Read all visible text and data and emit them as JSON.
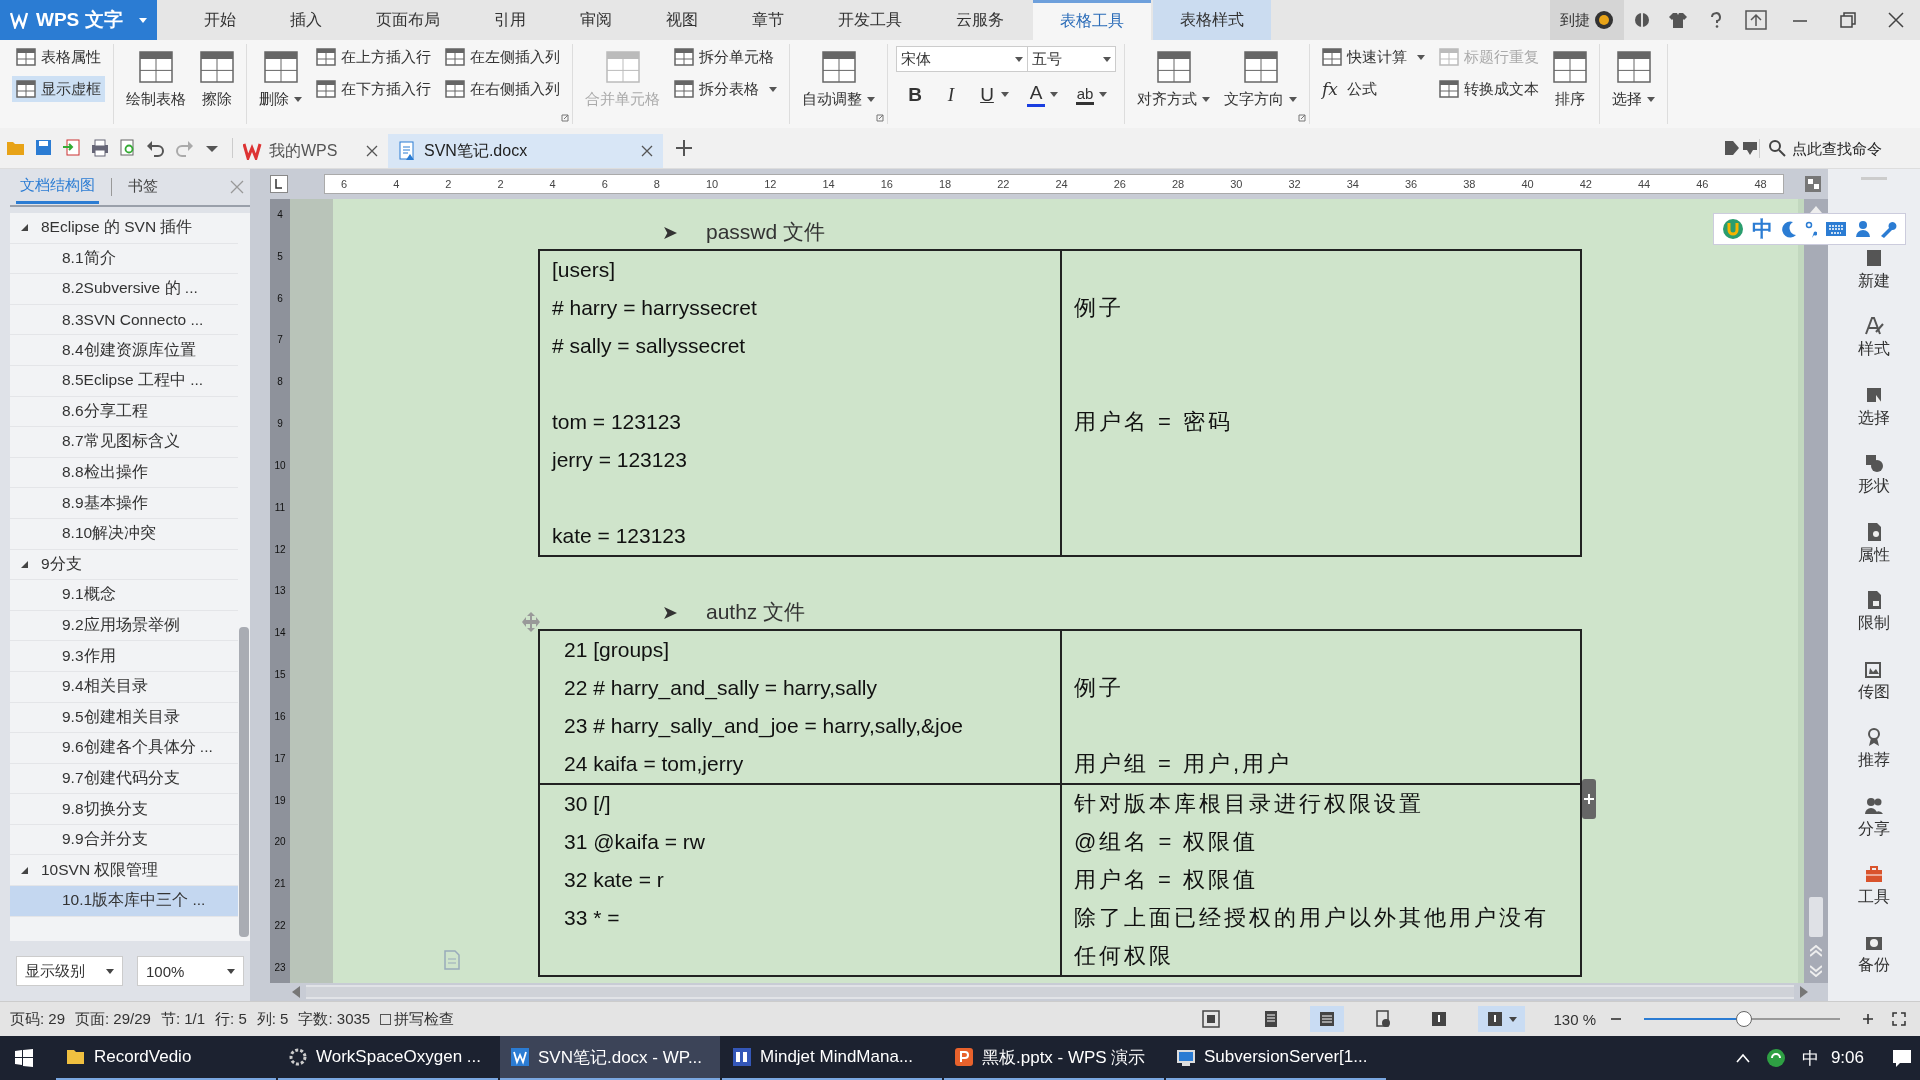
{
  "app_button": {
    "title": "WPS 文字"
  },
  "menu_tabs": [
    {
      "label": "开始",
      "selected": false
    },
    {
      "label": "插入",
      "selected": false
    },
    {
      "label": "页面布局",
      "selected": false
    },
    {
      "label": "引用",
      "selected": false
    },
    {
      "label": "审阅",
      "selected": false
    },
    {
      "label": "视图",
      "selected": false
    },
    {
      "label": "章节",
      "selected": false
    },
    {
      "label": "开发工具",
      "selected": false
    },
    {
      "label": "云服务",
      "selected": false
    },
    {
      "label": "表格工具",
      "selected": true
    },
    {
      "label": "表格样式",
      "selected": false
    }
  ],
  "user": {
    "name": "到捷"
  },
  "ribbon": [
    {
      "kind": "buttons",
      "launcher": false,
      "items": [
        {
          "label": "表格属性",
          "kind": "small",
          "active": false
        },
        {
          "label": "显示虚框",
          "kind": "small",
          "active": true
        }
      ]
    },
    {
      "kind": "buttons",
      "launcher": false,
      "items": [
        {
          "label": "绘制表格",
          "kind": "large"
        },
        {
          "label": "擦除",
          "kind": "large"
        }
      ]
    },
    {
      "kind": "buttons",
      "launcher": true,
      "items": [
        {
          "label": "删除",
          "kind": "large",
          "dropdown": true
        },
        {
          "label": "在上方插入行",
          "kind": "small"
        },
        {
          "label": "在下方插入行",
          "kind": "small"
        },
        {
          "label": "在左侧插入列",
          "kind": "small"
        },
        {
          "label": "在右侧插入列",
          "kind": "small"
        }
      ]
    },
    {
      "kind": "buttons",
      "launcher": false,
      "items": [
        {
          "label": "合并单元格",
          "kind": "large",
          "disabled": true
        },
        {
          "label": "拆分单元格",
          "kind": "small",
          "disabled": false
        },
        {
          "label": "拆分表格",
          "kind": "small",
          "dropdown": true,
          "disabled": false
        }
      ]
    },
    {
      "kind": "buttons",
      "launcher": true,
      "items": [
        {
          "label": "自动调整",
          "kind": "large",
          "dropdown": true
        }
      ]
    },
    {
      "kind": "font",
      "font": "宋体",
      "size": "五号",
      "buttons": [
        {
          "label": "B",
          "kind": "bold"
        },
        {
          "label": "I",
          "kind": "italic"
        },
        {
          "label": "U",
          "kind": "underline",
          "dropdown": true
        },
        {
          "label": "A",
          "kind": "color",
          "dropdown": true
        },
        {
          "label": "ab",
          "kind": "highlight",
          "dropdown": true
        }
      ]
    },
    {
      "kind": "buttons",
      "launcher": true,
      "items": [
        {
          "label": "对齐方式",
          "kind": "large",
          "dropdown": true
        },
        {
          "label": "文字方向",
          "kind": "large",
          "dropdown": true
        }
      ]
    },
    {
      "kind": "buttons",
      "launcher": false,
      "items": [
        {
          "label": "快速计算",
          "kind": "small",
          "dropdown": true,
          "disabled": false
        },
        {
          "label": "公式",
          "kind": "small",
          "glyph": "fx",
          "disabled": false
        },
        {
          "label": "标题行重复",
          "kind": "small",
          "disabled": true
        },
        {
          "label": "转换成文本",
          "kind": "small",
          "disabled": false
        },
        {
          "label": "排序",
          "kind": "large",
          "disabled": false
        }
      ]
    },
    {
      "kind": "buttons",
      "launcher": false,
      "items": [
        {
          "label": "选择",
          "kind": "large",
          "dropdown": true
        }
      ]
    }
  ],
  "doc_tabs": [
    {
      "label": "我的WPS",
      "selected": false
    },
    {
      "label": "SVN笔记.docx",
      "selected": true
    }
  ],
  "command_search": {
    "placeholder": "点此查找命令"
  },
  "sidebar": {
    "tabs": [
      {
        "label": "文档结构图",
        "selected": true
      },
      {
        "label": "书签",
        "selected": false
      }
    ],
    "outline": [
      {
        "label": "8Eclipse 的 SVN 插件",
        "expanded": true,
        "selected": false,
        "children": [
          {
            "label": "8.1简介",
            "selected": false
          },
          {
            "label": "8.2Subversive 的 ...",
            "selected": false
          },
          {
            "label": "8.3SVN Connecto ...",
            "selected": false
          },
          {
            "label": "8.4创建资源库位置",
            "selected": false
          },
          {
            "label": "8.5Eclipse 工程中 ...",
            "selected": false
          },
          {
            "label": "8.6分享工程",
            "selected": false
          },
          {
            "label": "8.7常见图标含义",
            "selected": false
          },
          {
            "label": "8.8检出操作",
            "selected": false
          },
          {
            "label": "8.9基本操作",
            "selected": false
          },
          {
            "label": "8.10解决冲突",
            "selected": false
          }
        ]
      },
      {
        "label": "9分支",
        "expanded": true,
        "selected": false,
        "children": [
          {
            "label": "9.1概念",
            "selected": false
          },
          {
            "label": "9.2应用场景举例",
            "selected": false
          },
          {
            "label": "9.3作用",
            "selected": false
          },
          {
            "label": "9.4相关目录",
            "selected": false
          },
          {
            "label": "9.5创建相关目录",
            "selected": false
          },
          {
            "label": "9.6创建各个具体分 ...",
            "selected": false
          },
          {
            "label": "9.7创建代码分支",
            "selected": false
          },
          {
            "label": "9.8切换分支",
            "selected": false
          },
          {
            "label": "9.9合并分支",
            "selected": false
          }
        ]
      },
      {
        "label": "10SVN 权限管理",
        "expanded": true,
        "selected": false,
        "children": [
          {
            "label": "10.1版本库中三个 ...",
            "selected": true
          }
        ]
      }
    ],
    "level_select": "显示级别",
    "zoom_select": "100%"
  },
  "h_ruler": [
    "6",
    "4",
    "2",
    "2",
    "4",
    "6",
    "8",
    "10",
    "12",
    "14",
    "16",
    "18",
    "22",
    "24",
    "26",
    "28",
    "30",
    "32",
    "34",
    "36",
    "38",
    "40",
    "42",
    "44",
    "46",
    "48"
  ],
  "v_ruler": [
    "4",
    "5",
    "6",
    "7",
    "8",
    "9",
    "10",
    "11",
    "12",
    "13",
    "14",
    "15",
    "16",
    "17",
    "19",
    "20",
    "21",
    "22",
    "23"
  ],
  "ime_bar": {
    "label": "中"
  },
  "document": [
    {
      "bullet": "➤",
      "heading": "passwd 文件",
      "rows": [
        {
          "lines": [
            {
              "kind": "line",
              "code": "[users]"
            },
            {
              "kind": "line",
              "code": "# harry = harryssecret",
              "note": "例子"
            },
            {
              "kind": "line",
              "code": "# sally = sallyssecret"
            },
            {
              "kind": "gap"
            },
            {
              "kind": "line",
              "code": "tom = 123123",
              "note": "用户名  =  密码"
            },
            {
              "kind": "line",
              "code": "jerry = 123123"
            },
            {
              "kind": "gap"
            },
            {
              "kind": "line",
              "code": "kate = 123123"
            }
          ]
        }
      ]
    },
    {
      "bullet": "➤",
      "heading": "authz 文件",
      "rows": [
        {
          "lines": [
            {
              "kind": "line",
              "code": "21 [groups]"
            },
            {
              "kind": "line",
              "code": "22 # harry_and_sally = harry,sally",
              "note": "例子"
            },
            {
              "kind": "line",
              "code": "23 # harry_sally_and_joe = harry,sally,&joe"
            },
            {
              "kind": "line",
              "code": "24 kaifa = tom,jerry",
              "note": "用户组  =  用户,用户"
            }
          ]
        },
        {
          "lines": [
            {
              "kind": "line",
              "code": "30 [/]",
              "note": "针对版本库根目录进行权限设置"
            },
            {
              "kind": "line",
              "code": "31 @kaifa = rw",
              "note": "@组名  =  权限值"
            },
            {
              "kind": "line",
              "code": "32 kate = r",
              "note": "用户名  =  权限值"
            },
            {
              "kind": "line",
              "code": "33 * =",
              "note": "除了上面已经授权的用户以外其他用户没有任何权限"
            }
          ]
        }
      ]
    }
  ],
  "right_panel": [
    {
      "label": "新建"
    },
    {
      "label": "样式"
    },
    {
      "label": "选择"
    },
    {
      "label": "形状"
    },
    {
      "label": "属性"
    },
    {
      "label": "限制"
    },
    {
      "label": "传图"
    },
    {
      "label": "推荐"
    },
    {
      "label": "分享"
    },
    {
      "label": "工具"
    },
    {
      "label": "备份"
    }
  ],
  "status_bar": {
    "fields": [
      "页码: 29",
      "页面: 29/29",
      "节: 1/1",
      "行: 5",
      "列: 5",
      "字数: 3035"
    ],
    "spell_check": {
      "label": "拼写检查",
      "checked": false
    },
    "views": [
      {
        "selected": false
      },
      {
        "selected": true
      },
      {
        "selected": false
      },
      {
        "selected": false
      },
      {
        "selected": true
      }
    ],
    "zoom": {
      "reading": "130 %",
      "level": 0.51
    }
  },
  "taskbar": {
    "items": [
      {
        "label": "RecordVedio",
        "selected": false
      },
      {
        "label": "WorkSpaceOxygen ...",
        "selected": false
      },
      {
        "label": "SVN笔记.docx - WP...",
        "selected": true
      },
      {
        "label": "Mindjet MindMana...",
        "selected": false
      },
      {
        "label": "黑板.pptx - WPS 演示",
        "selected": false
      },
      {
        "label": "SubversionServer[1...",
        "selected": false
      }
    ],
    "ime": "中",
    "time": "9:06"
  }
}
